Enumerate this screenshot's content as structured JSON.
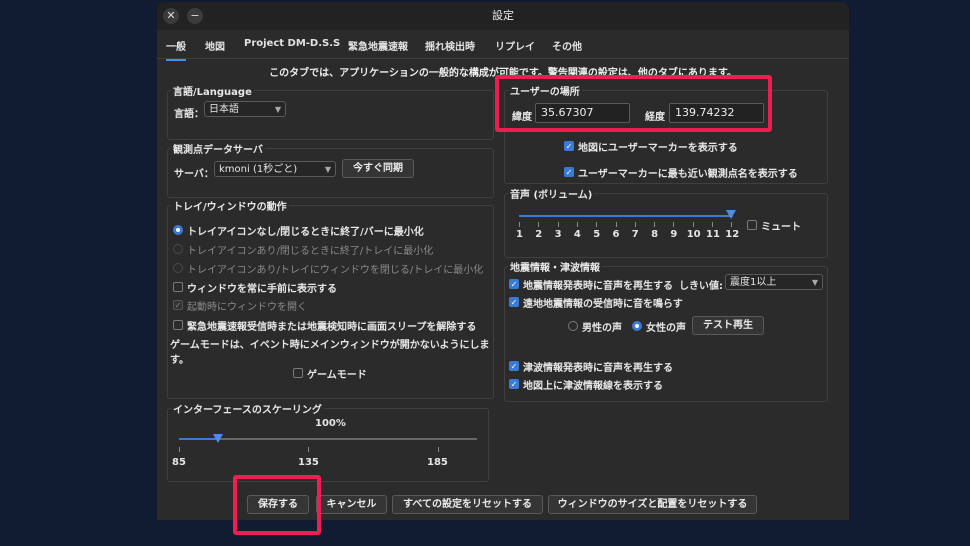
{
  "window": {
    "title": "設定"
  },
  "tabs": [
    "一般",
    "地図",
    "Project DM-D.S.S",
    "緊急地震速報",
    "揺れ検出時",
    "リプレイ",
    "その他"
  ],
  "notice": "このタブでは、アプリケーションの一般的な構成が可能です。警告関連の設定は、他のタブにあります。",
  "language": {
    "title": "言語/Language",
    "label": "言語：",
    "value": "日本語"
  },
  "server": {
    "title": "観測点データサーバ",
    "label": "サーバ：",
    "value": "kmoni (1秒ごと)",
    "sync_button": "今すぐ同期"
  },
  "tray": {
    "title": "トレイ/ウィンドウの動作",
    "options": [
      "トレイアイコンなし/閉じるときに終了/バーに最小化",
      "トレイアイコンあり/閉じるときに終了/トレイに最小化",
      "トレイアイコンあり/トレイにウィンドウを閉じる/トレイに最小化"
    ],
    "always_on_top": "ウィンドウを常に手前に表示する",
    "open_on_start": "起動時にウィンドウを開く",
    "release_sleep": "緊急地震速報受信時または地震検知時に画面スリープを解除する",
    "game_mode_note_1": "ゲームモードは、イベント時にメインウィンドウが開かないようにしま",
    "game_mode_note_2": "す。",
    "game_mode": "ゲームモード"
  },
  "scaling": {
    "title": "インターフェースのスケーリング",
    "value_label": "100%",
    "ticks": [
      "85",
      "135",
      "185"
    ],
    "min": 85,
    "max": 185,
    "value": 100
  },
  "location": {
    "title": "ユーザーの場所",
    "lat_label": "緯度",
    "lat": "35.67307",
    "lon_label": "経度",
    "lon": "139.74232",
    "show_marker": "地図にユーザーマーカーを表示する",
    "show_nearest": "ユーザーマーカーに最も近い観測点名を表示する"
  },
  "volume": {
    "title": "音声 (ボリューム)",
    "ticks": [
      "1",
      "2",
      "3",
      "4",
      "5",
      "6",
      "7",
      "8",
      "9",
      "10",
      "11",
      "12"
    ],
    "value": 12,
    "mute": "ミュート"
  },
  "quake": {
    "title": "地震情報・津波情報",
    "play_sound": "地震情報発表時に音声を再生する",
    "threshold_label": "しきい値:",
    "threshold": "震度1以上",
    "distant": "遠地地震情報の受信時に音を鳴らす",
    "male": "男性の声",
    "female": "女性の声",
    "test_button": "テスト再生",
    "tsunami_sound": "津波情報発表時に音声を再生する",
    "tsunami_map": "地図上に津波情報線を表示する"
  },
  "buttons": {
    "save": "保存する",
    "cancel": "キャンセル",
    "reset_all": "すべての設定をリセットする",
    "reset_window": "ウィンドウのサイズと配置をリセットする"
  },
  "colors": {
    "accent": "#3a7bd5",
    "highlight": "#ee1e50"
  }
}
